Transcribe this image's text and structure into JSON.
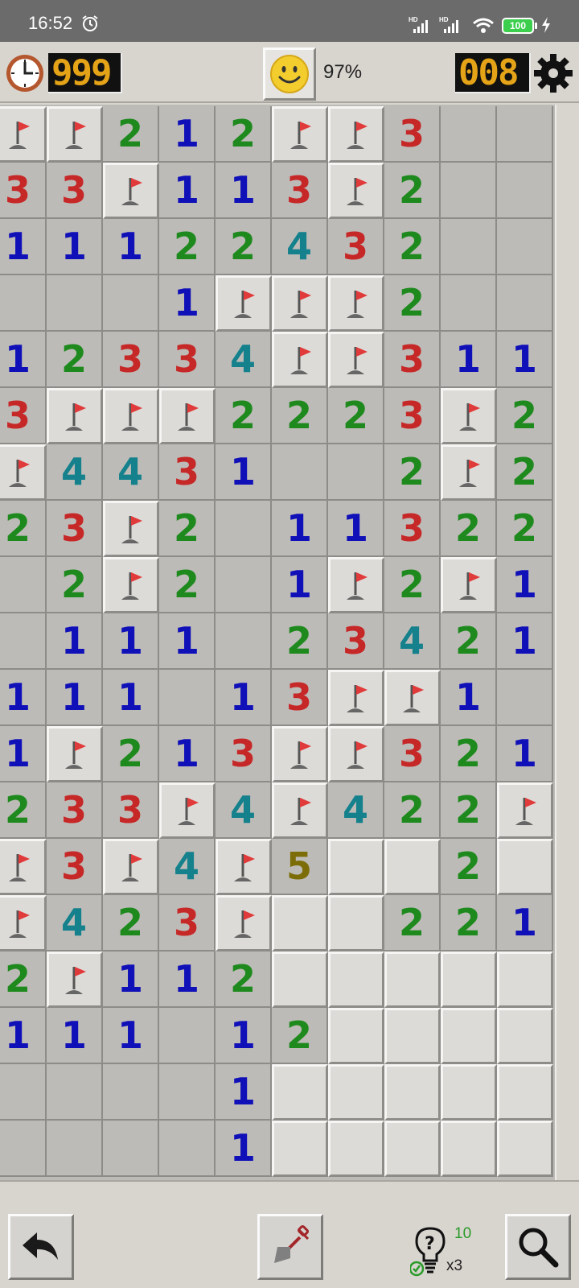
{
  "status_bar": {
    "time": "16:52",
    "battery": "100",
    "icons": [
      "alarm-icon",
      "hd-signal-icon",
      "hd-signal-icon",
      "wifi-icon",
      "battery-icon",
      "charging-icon"
    ]
  },
  "header": {
    "timer": "999",
    "progress": "97%",
    "mines_left": "008",
    "icons": [
      "clock-icon",
      "smiley-icon",
      "gear-icon"
    ]
  },
  "board": {
    "columns": 10,
    "rows": 19,
    "legend": "F = flag, R = raised empty tile, . = revealed empty, digits = adjacent mine count",
    "cells": [
      "FF212FF3..",
      "33F113F2..",
      "1112243 2..",
      "...1FFF2..",
      "12334FF311",
      "3FFF2223F2",
      "F4431..2F2",
      "23F2.11322",
      ".2F2.1F2F1",
      ".111.23421",
      "111.13FF1.",
      "1F213FF321",
      "233F4F422F",
      "F3F4F5RR2R",
      "F423FRR221",
      "2F112RRRRR",
      "111.12RRRR",
      "....1RRRRR",
      "....1RRRRR"
    ]
  },
  "colors": {
    "n1": "#1010b8",
    "n2": "#1e8a1e",
    "n3": "#c62828",
    "n4": "#14818c",
    "n5": "#7c6d08",
    "counter_digits": "#e5a318"
  },
  "bottom_bar": {
    "hint_count": "10",
    "hint_multiplier": "x3",
    "icons": [
      "undo-icon",
      "shovel-icon",
      "hint-bulb-icon",
      "magnifier-icon"
    ]
  }
}
